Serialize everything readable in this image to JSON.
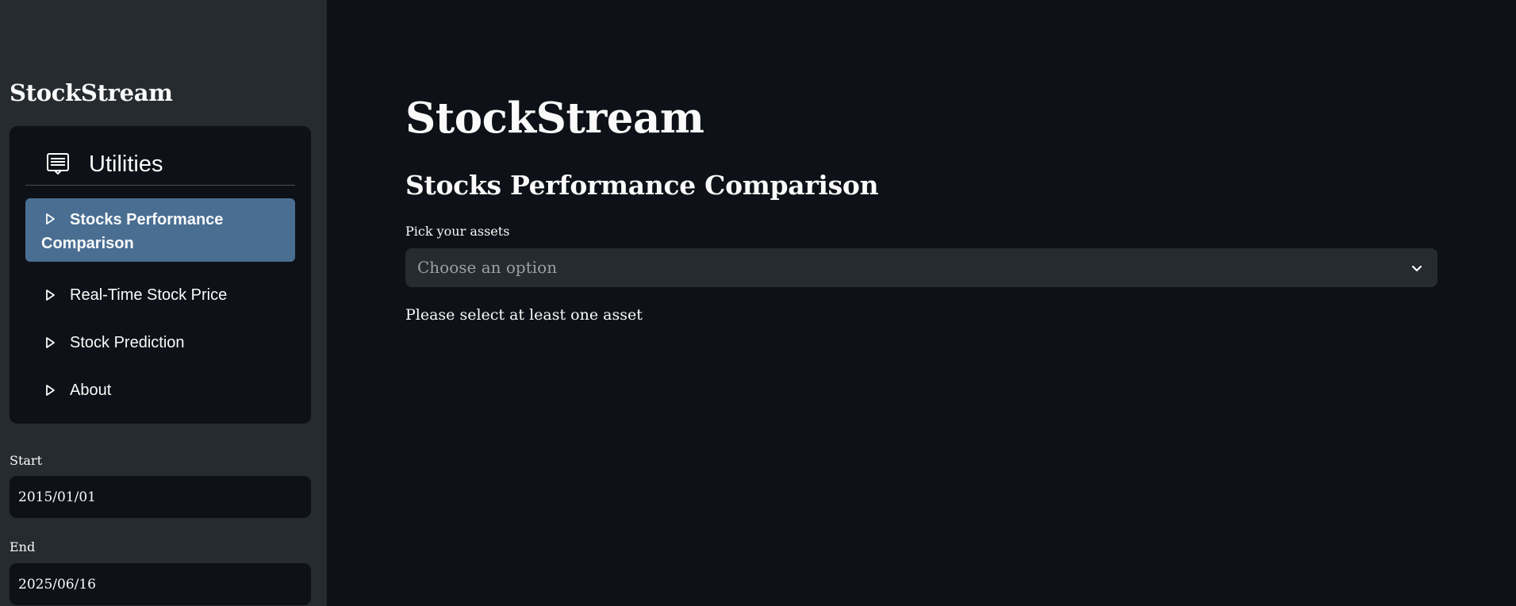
{
  "sidebar": {
    "title": "StockStream",
    "menu": {
      "header_icon": "list-icon",
      "header": "Utilities",
      "items": [
        {
          "label": "Stocks Performance Comparison",
          "icon": "triangle-right-icon",
          "active": true
        },
        {
          "label": "Real-Time Stock Price",
          "icon": "triangle-right-icon",
          "active": false
        },
        {
          "label": "Stock Prediction",
          "icon": "triangle-right-icon",
          "active": false
        },
        {
          "label": "About",
          "icon": "triangle-right-icon",
          "active": false
        }
      ]
    },
    "start": {
      "label": "Start",
      "value": "2015/01/01"
    },
    "end": {
      "label": "End",
      "value": "2025/06/16"
    }
  },
  "main": {
    "title": "StockStream",
    "subtitle": "Stocks Performance Comparison",
    "assets_label": "Pick your assets",
    "assets_placeholder": "Choose an option",
    "dropdown_icon": "chevron-down-icon",
    "info": "Please select at least one asset"
  },
  "colors": {
    "app_background": "#0e1117",
    "sidebar_background": "#262b30",
    "active_menu": "#4a6e92",
    "text": "#fafafa",
    "placeholder": "#9ba0a6"
  }
}
